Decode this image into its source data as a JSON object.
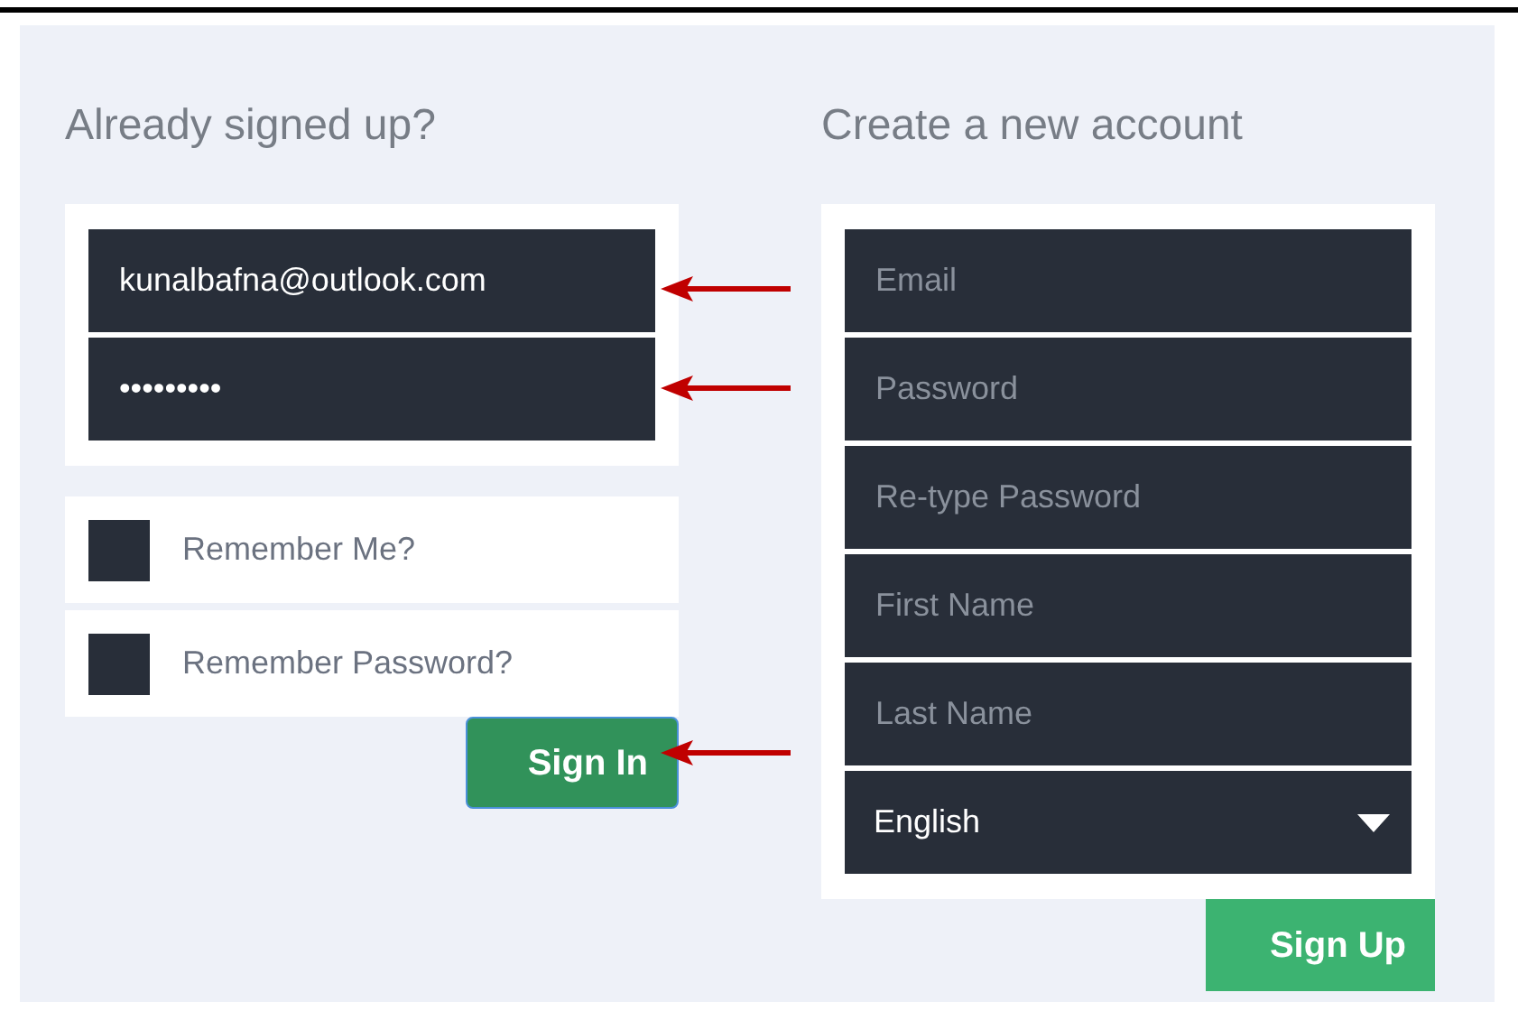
{
  "sign_in": {
    "heading": "Already signed up?",
    "fields": [
      {
        "value": "kunalbafna@outlook.com"
      },
      {
        "value": "•••••••••"
      }
    ],
    "options": [
      {
        "label": "Remember Me?",
        "checked": false
      },
      {
        "label": "Remember Password?",
        "checked": false
      }
    ],
    "button": "Sign In"
  },
  "sign_up": {
    "heading": "Create a new account",
    "fields": [
      {
        "kind": "text",
        "placeholder": "Email"
      },
      {
        "kind": "text",
        "placeholder": "Password"
      },
      {
        "kind": "text",
        "placeholder": "Re-type Password"
      },
      {
        "kind": "text",
        "placeholder": "First Name"
      },
      {
        "kind": "text",
        "placeholder": "Last Name"
      },
      {
        "kind": "select",
        "value": "English"
      }
    ],
    "button": "Sign Up"
  }
}
